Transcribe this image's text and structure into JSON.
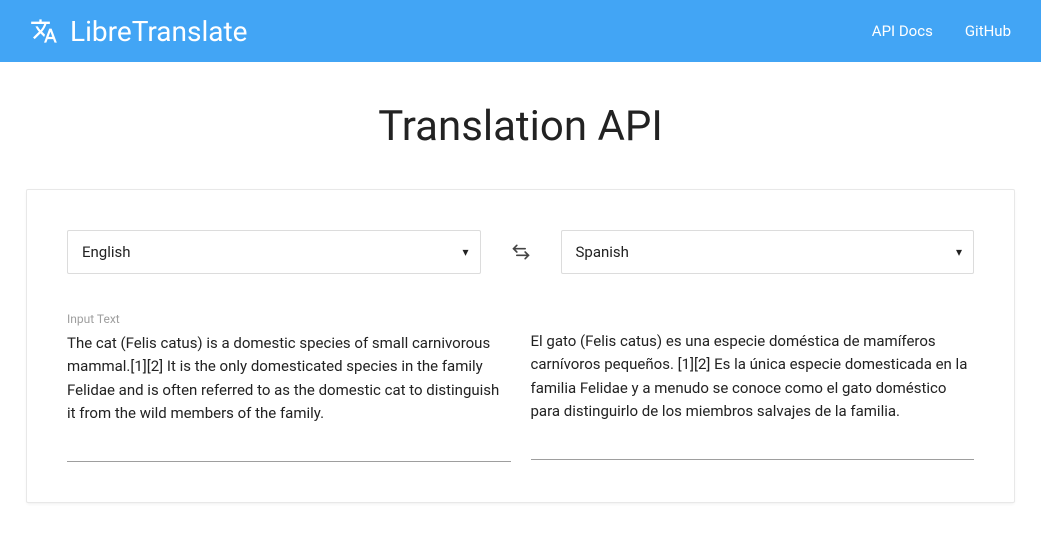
{
  "header": {
    "brand_title": "LibreTranslate",
    "nav": {
      "api_docs": "API Docs",
      "github": "GitHub"
    }
  },
  "page_title": "Translation API",
  "source_lang": {
    "selected": "English"
  },
  "target_lang": {
    "selected": "Spanish"
  },
  "input": {
    "label": "Input Text",
    "value": "The cat (Felis catus) is a domestic species of small carnivorous mammal.[1][2] It is the only domesticated species in the family Felidae and is often referred to as the domestic cat to distinguish it from the wild members of the family."
  },
  "output": {
    "value": "El gato (Felis catus) es una especie doméstica de mamíferos carnívoros pequeños. [1][2] Es la única especie domesticada en la familia Felidae y a menudo se conoce como el gato doméstico para distinguirlo de los miembros salvajes de la familia."
  }
}
